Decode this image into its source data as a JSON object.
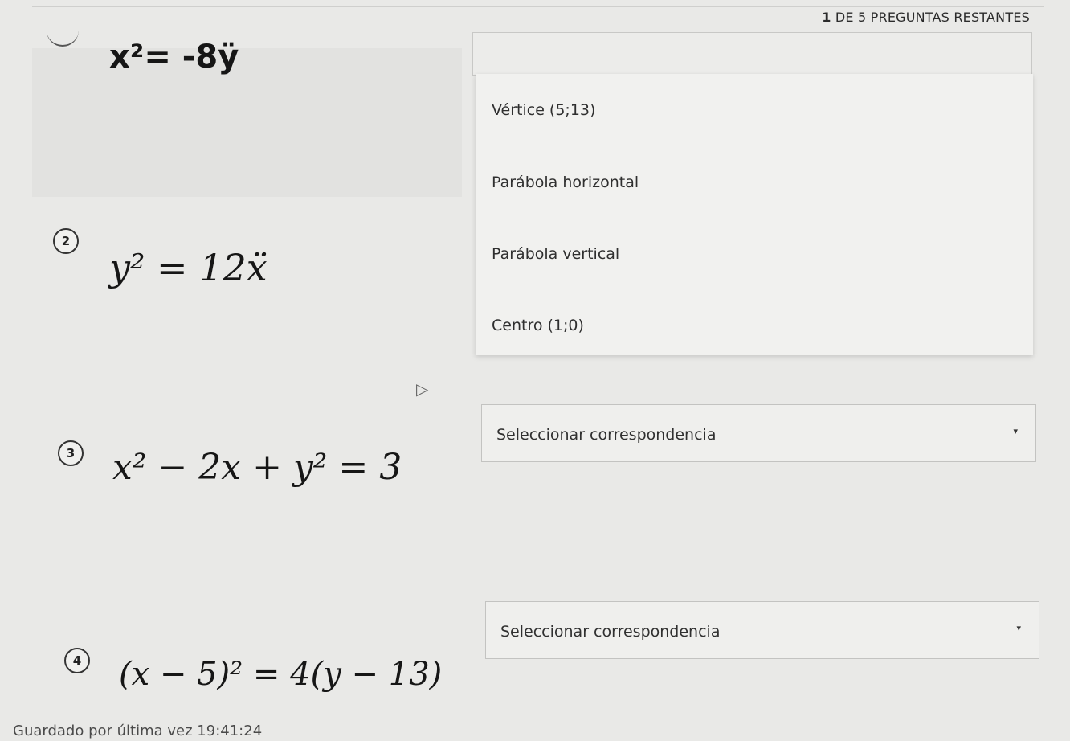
{
  "header": {
    "remaining_count": "1",
    "remaining_text": "DE 5 PREGUNTAS RESTANTES"
  },
  "questions": [
    {
      "number": "",
      "equation": "x²= -8ÿ"
    },
    {
      "number": "2",
      "equation": "y² = 12ẍ"
    },
    {
      "number": "3",
      "equation": "x² − 2x + y² = 3"
    },
    {
      "number": "4",
      "equation": "(x − 5)² = 4(y − 13)"
    }
  ],
  "dropdown_options": [
    "Vértice (5;13)",
    "Parábola horizontal",
    "Parábola vertical",
    "Centro (1;0)"
  ],
  "selects": [
    {
      "label": "Seleccionar correspondencia"
    },
    {
      "label": "Seleccionar correspondencia"
    }
  ],
  "footer": {
    "saved_text": "Guardado por última vez 19:41:24"
  },
  "icons": {
    "dropdown_arrow": "▾",
    "cursor": "▷"
  }
}
